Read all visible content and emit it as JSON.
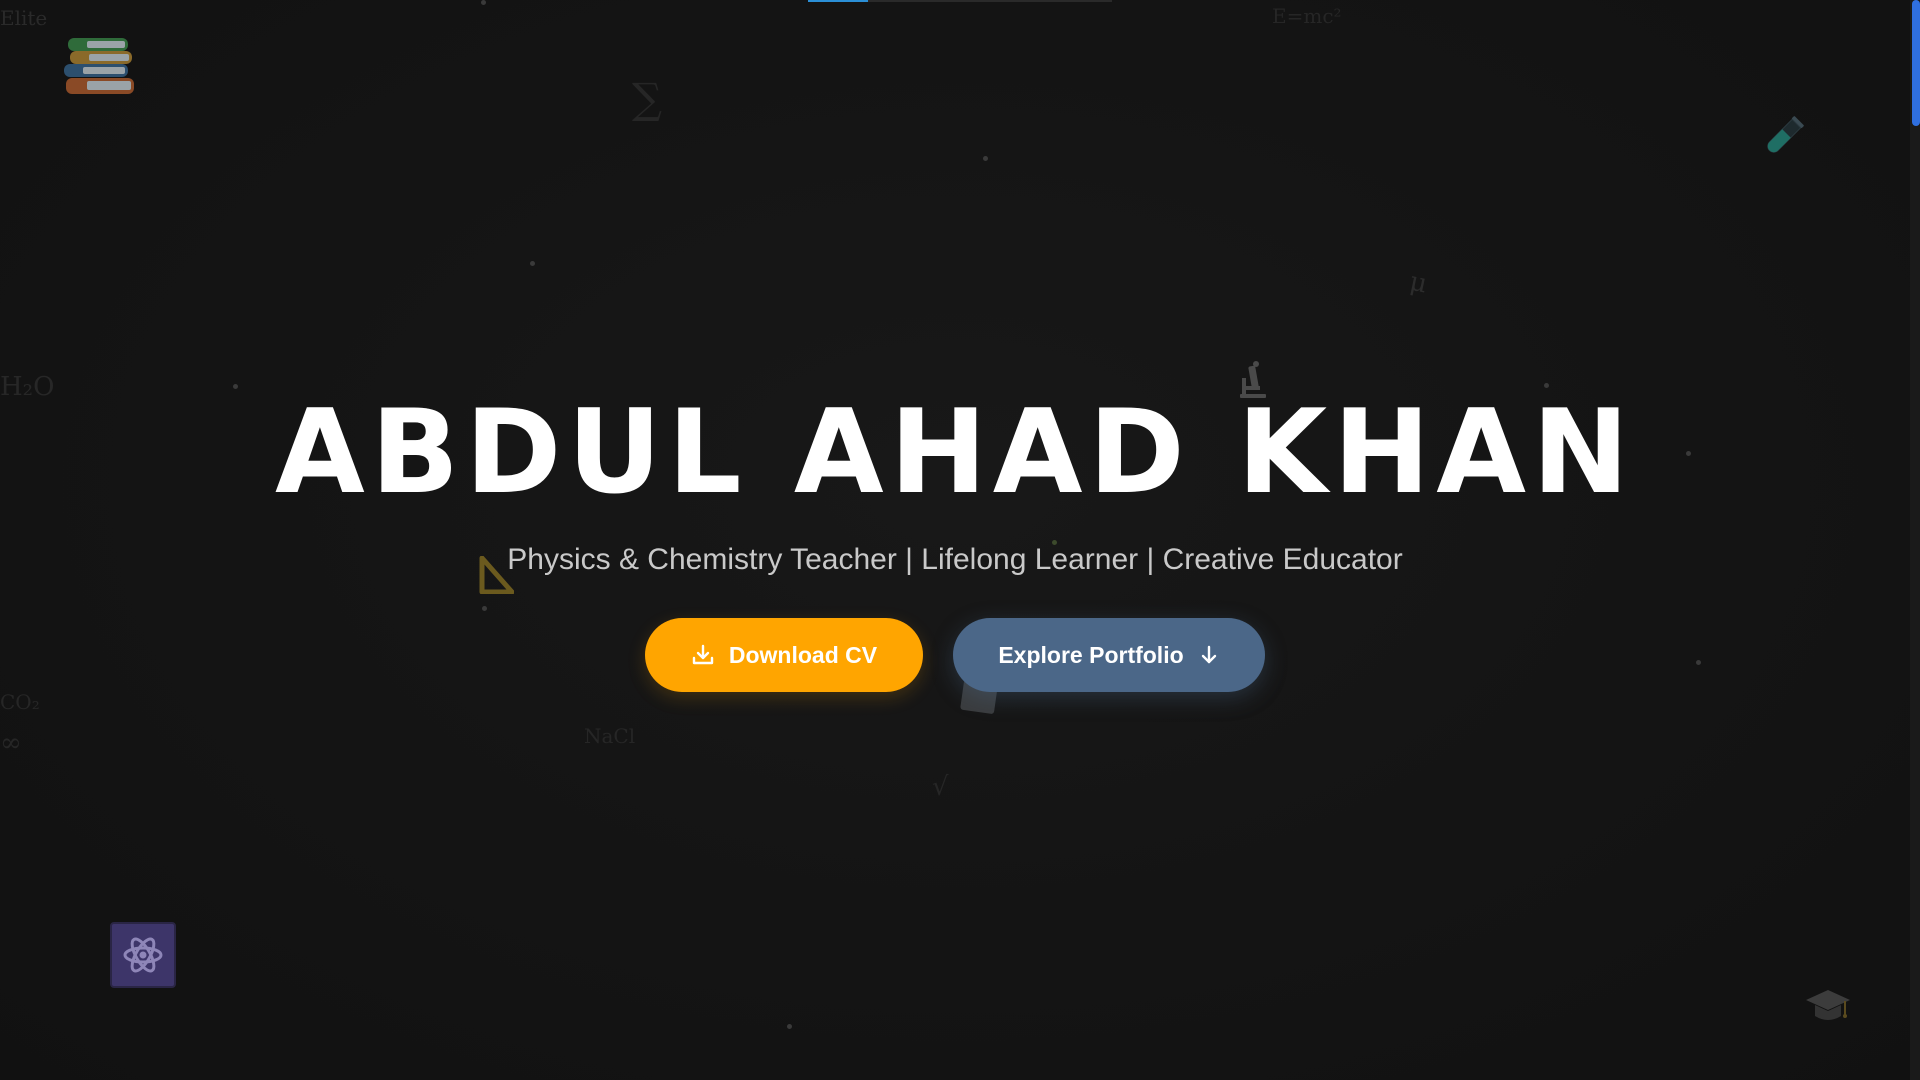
{
  "hero": {
    "name": "ABDUL AHAD KHAN",
    "tagline": "Physics & Chemistry Teacher | Lifelong Learner | Creative Educator"
  },
  "actions": {
    "download_cv_label": "Download CV",
    "explore_portfolio_label": "Explore Portfolio"
  },
  "background_symbols": {
    "top_left": "Elite",
    "sigma": "∑",
    "equation": "E=mc²",
    "water": "H₂O",
    "mu": "μ",
    "carbon_dioxide": "CO₂",
    "infinity": "∞",
    "salt": "NaCl",
    "sqrt": "√"
  },
  "icons": {
    "books": "books-icon",
    "test_tube": "test-tube-icon",
    "microscope": "microscope-icon",
    "triangle_ruler": "triangle-ruler-icon",
    "graduation_cap": "graduation-cap-icon",
    "atom": "atom-icon",
    "download": "download-icon",
    "arrow_down": "arrow-down-icon"
  },
  "colors": {
    "background": "#141414",
    "primary_button": "#ffa500",
    "secondary_button": "#4b6788",
    "scroll_thumb": "#2f6fe0",
    "nav_indicator": "#2b8fd6",
    "atom_button": "#3d3569"
  }
}
